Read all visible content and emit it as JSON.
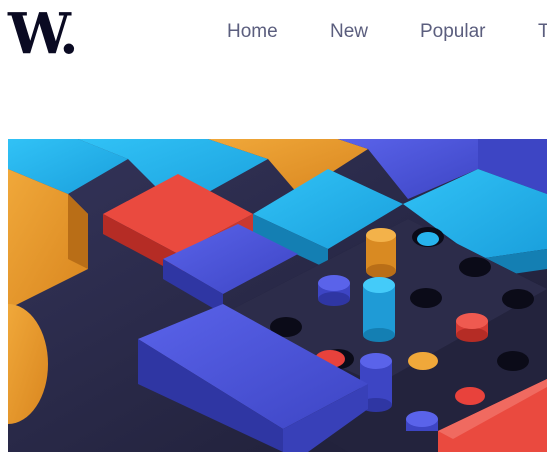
{
  "header": {
    "logo_text": "W."
  },
  "nav": {
    "items": [
      {
        "label": "Home"
      },
      {
        "label": "New"
      },
      {
        "label": "Popular"
      },
      {
        "label": "T"
      }
    ]
  },
  "colors": {
    "brand": "#0a0a22",
    "nav_text": "#5b5e7e",
    "hero_blue": "#4b55d9",
    "hero_cyan": "#27b4ee",
    "hero_orange": "#e89a2c",
    "hero_red": "#e8423c",
    "hero_dark": "#2a2a44"
  }
}
